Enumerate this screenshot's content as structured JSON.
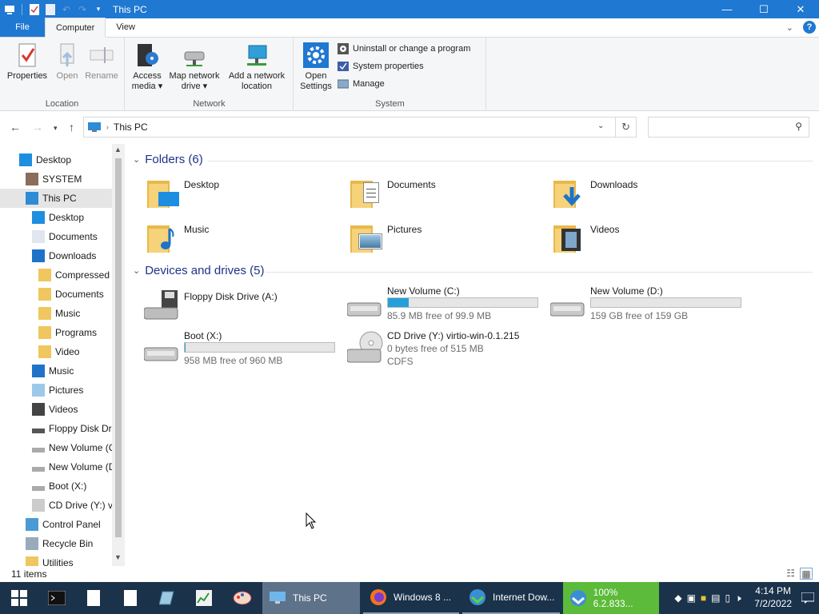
{
  "window": {
    "title": "This PC"
  },
  "titlebar": {
    "minimize": "—",
    "maximize": "☐",
    "close": "✕"
  },
  "tabs": [
    "File",
    "Computer",
    "View"
  ],
  "ribbon": {
    "location": {
      "label": "Location",
      "properties": "Properties",
      "open": "Open",
      "rename": "Rename"
    },
    "network": {
      "label": "Network",
      "access_media_1": "Access",
      "access_media_2": "media ▾",
      "map_drive_1": "Map network",
      "map_drive_2": "drive ▾",
      "add_location_1": "Add a network",
      "add_location_2": "location"
    },
    "system": {
      "label": "System",
      "open_settings_1": "Open",
      "open_settings_2": "Settings",
      "uninstall": "Uninstall or change a program",
      "properties": "System properties",
      "manage": "Manage"
    }
  },
  "address": {
    "path": "This PC",
    "search_placeholder": ""
  },
  "nav": [
    {
      "label": "Desktop"
    },
    {
      "label": "SYSTEM"
    },
    {
      "label": "This PC"
    },
    {
      "label": "Desktop"
    },
    {
      "label": "Documents"
    },
    {
      "label": "Downloads"
    },
    {
      "label": "Compressed"
    },
    {
      "label": "Documents"
    },
    {
      "label": "Music"
    },
    {
      "label": "Programs"
    },
    {
      "label": "Video"
    },
    {
      "label": "Music"
    },
    {
      "label": "Pictures"
    },
    {
      "label": "Videos"
    },
    {
      "label": "Floppy Disk Dri"
    },
    {
      "label": "New Volume (C"
    },
    {
      "label": "New Volume (D"
    },
    {
      "label": "Boot (X:)"
    },
    {
      "label": "CD Drive (Y:) vi"
    },
    {
      "label": "Control Panel"
    },
    {
      "label": "Recycle Bin"
    },
    {
      "label": "Utilities"
    }
  ],
  "folders": {
    "header": "Folders (6)",
    "items": [
      "Desktop",
      "Documents",
      "Downloads",
      "Music",
      "Pictures",
      "Videos"
    ]
  },
  "drives": {
    "header": "Devices and drives (5)",
    "items": [
      {
        "name": "Floppy Disk Drive (A:)"
      },
      {
        "name": "New Volume (C:)",
        "free": "85.9 MB free of 99.9 MB",
        "used_fraction": 0.14
      },
      {
        "name": "New Volume (D:)",
        "free": "159 GB free of 159 GB",
        "used_fraction": 0.0
      },
      {
        "name": "Boot (X:)",
        "free": "958 MB free of 960 MB",
        "used_fraction": 0.002
      },
      {
        "name": "CD Drive (Y:) virtio-win-0.1.215",
        "free": "0 bytes free of 515 MB",
        "fs": "CDFS"
      }
    ]
  },
  "status": {
    "count": "11 items"
  },
  "taskbar": {
    "apps": [
      {
        "label": "This PC"
      },
      {
        "label": "Windows 8 ..."
      },
      {
        "label": "Internet Dow..."
      },
      {
        "label": "100% 6.2.833..."
      }
    ],
    "time": "4:14 PM",
    "date": "7/2/2022"
  },
  "colors": {
    "accent": "#1f78d1",
    "drive_bar": "#26a0da",
    "taskbar": "#1a324a",
    "progress_app": "#5cbb3a"
  }
}
